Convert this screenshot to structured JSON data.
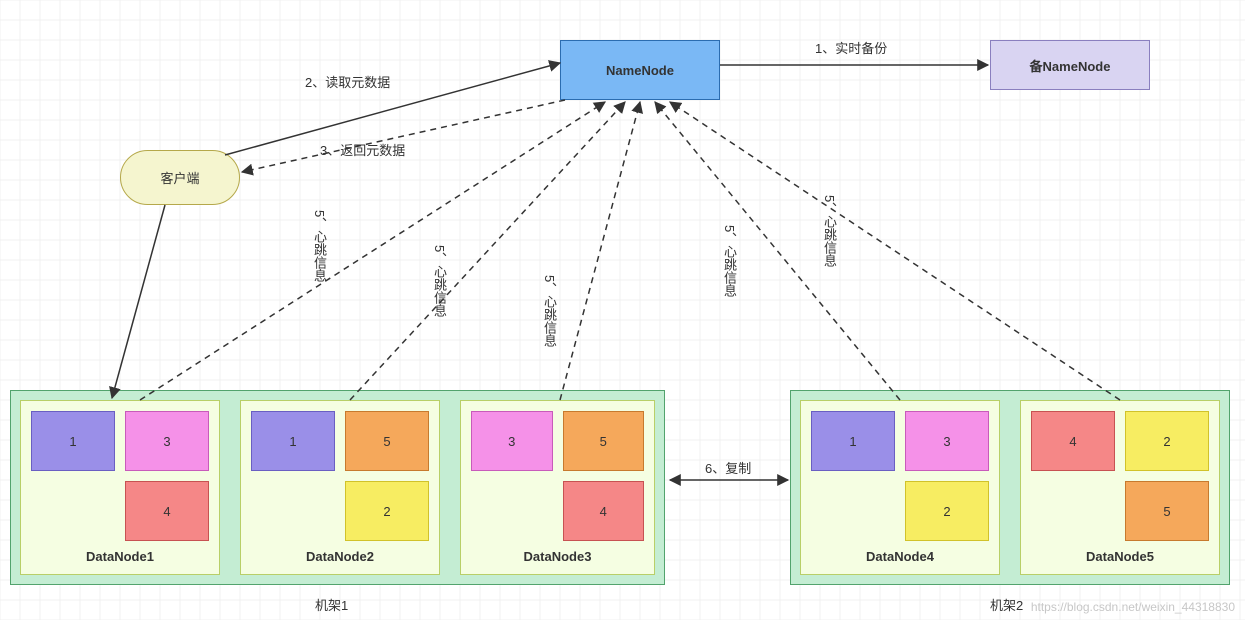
{
  "nodes": {
    "client": {
      "label": "客户端"
    },
    "namenode": {
      "label": "NameNode"
    },
    "secondary_namenode": {
      "label": "备NameNode"
    }
  },
  "edges": {
    "realtime_backup": "1、实时备份",
    "read_metadata": "2、读取元数据",
    "return_metadata": "3、返回元数据",
    "heartbeat": "5、心跳信息",
    "replication": "6、复制"
  },
  "racks": [
    {
      "label": "机架1",
      "datanodes": [
        {
          "name": "DataNode1",
          "blocks": [
            "1",
            "3",
            "",
            "4"
          ]
        },
        {
          "name": "DataNode2",
          "blocks": [
            "1",
            "5",
            "",
            "2"
          ]
        },
        {
          "name": "DataNode3",
          "blocks": [
            "3",
            "5",
            "",
            "4"
          ]
        }
      ]
    },
    {
      "label": "机架2",
      "datanodes": [
        {
          "name": "DataNode4",
          "blocks": [
            "1",
            "3",
            "",
            "2"
          ]
        },
        {
          "name": "DataNode5",
          "blocks": [
            "4",
            "2",
            "",
            "5"
          ]
        }
      ]
    }
  ],
  "block_colors": {
    "1": "b1",
    "2": "b2",
    "3": "b3",
    "4": "b4",
    "5": "b5"
  },
  "watermark": "https://blog.csdn.net/weixin_44318830"
}
